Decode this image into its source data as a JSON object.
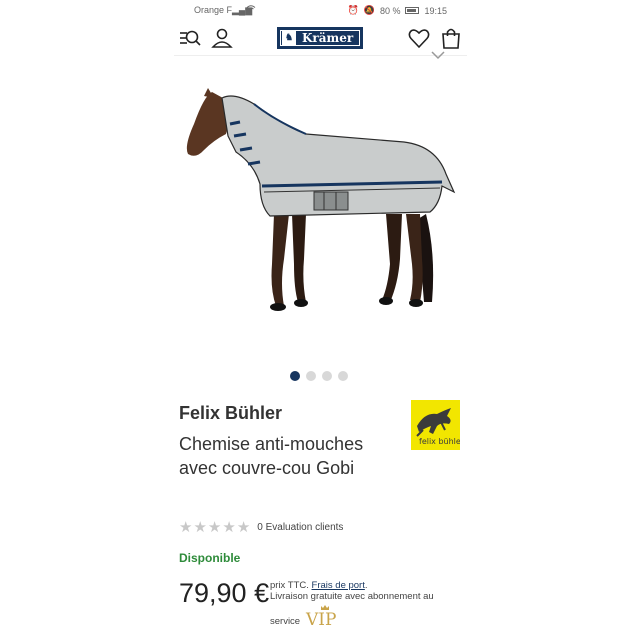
{
  "status_bar": {
    "carrier": "Orange F",
    "battery": "80 %",
    "time": "19:15"
  },
  "header": {
    "logo_text": "Krämer",
    "icons": [
      "search-menu-icon",
      "user-icon",
      "heart-icon",
      "shopping-bag-icon"
    ]
  },
  "gallery": {
    "slides": 4,
    "active_index": 0
  },
  "product": {
    "brand": "Felix Bühler",
    "brand_logo_text": "felix bühler",
    "title": "Chemise anti-mouches avec couvre-cou Gobi",
    "rating_count_text": "0 Evaluation clients",
    "rating_stars": 0,
    "availability": "Disponible",
    "price": "79,90 €",
    "price_note": "prix TTC.",
    "shipping_link": "Frais de port",
    "vip_note": "Livraison gratuite avec abonnement au",
    "service_label": "service",
    "vip_label": "VIP"
  },
  "colors": {
    "brand_navy": "#16355f",
    "available_green": "#2e8b3a",
    "vip_gold": "#c9a44a",
    "brand_logo_yellow": "#f2e600"
  }
}
